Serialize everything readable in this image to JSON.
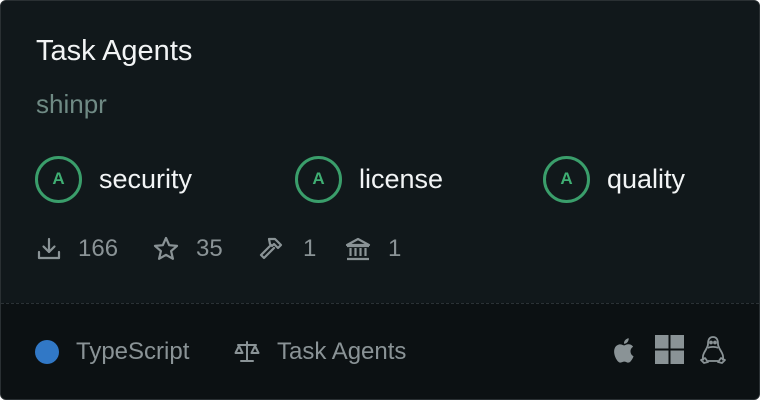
{
  "package": {
    "title": "Task Agents",
    "author": "shinpr"
  },
  "scores": [
    {
      "grade": "A",
      "label": "security"
    },
    {
      "grade": "A",
      "label": "license"
    },
    {
      "grade": "A",
      "label": "quality"
    }
  ],
  "stats": {
    "downloads": "166",
    "stars": "35",
    "tools": "1",
    "institutions": "1"
  },
  "footer": {
    "language": "TypeScript",
    "language_color": "#3178c6",
    "license": "Task Agents"
  },
  "platforms": [
    "apple-icon",
    "windows-icon",
    "linux-icon"
  ],
  "colors": {
    "grade_accent": "#3a9e6b",
    "card_background": "#11181b"
  }
}
